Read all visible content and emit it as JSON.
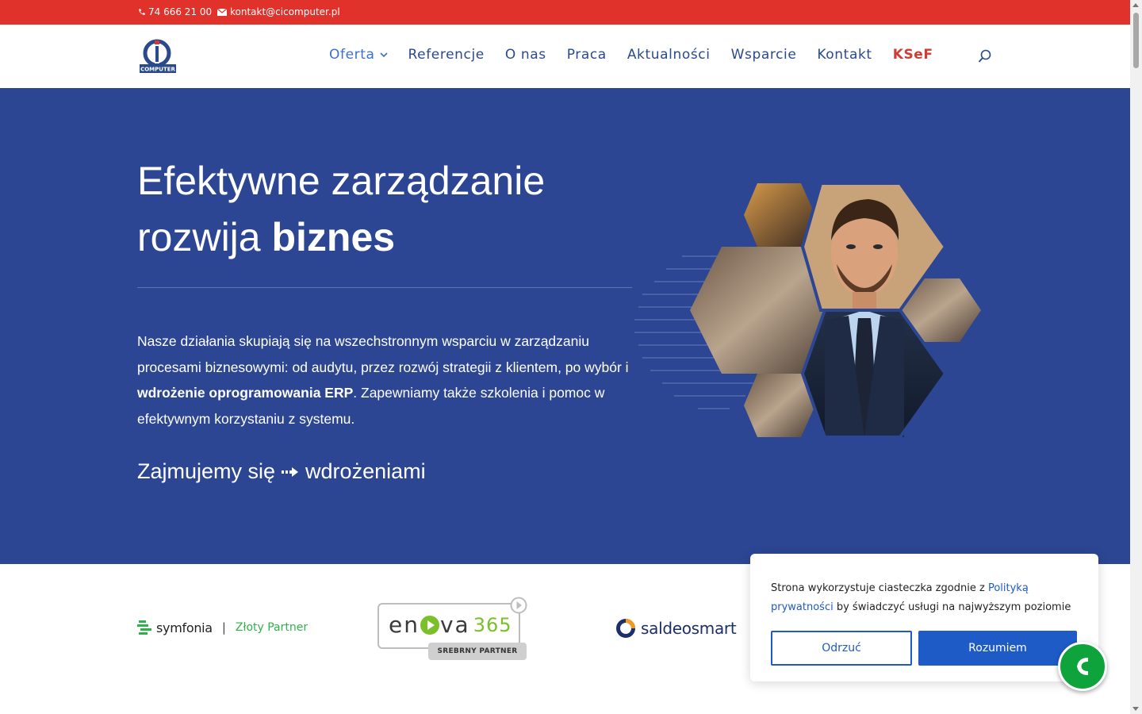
{
  "topbar": {
    "phone": "74 666 21 00",
    "email": "kontakt@cicomputer.pl",
    "phone_icon": "phone-icon",
    "email_icon": "envelope-icon",
    "background": "#e0312b"
  },
  "logo": {
    "text": "COMPUTER"
  },
  "nav": {
    "items": [
      {
        "label": "Oferta",
        "has_dropdown": true
      },
      {
        "label": "Referencje"
      },
      {
        "label": "O nas"
      },
      {
        "label": "Praca"
      },
      {
        "label": "Aktualności"
      },
      {
        "label": "Wsparcie"
      },
      {
        "label": "Kontakt"
      },
      {
        "label": "KSeF"
      }
    ],
    "search_icon": "search-icon",
    "text_color": "#2a4a8c",
    "highlight_color": "#d33a35"
  },
  "hero": {
    "background": "#2c4694",
    "title_line1": "Efektywne zarządzanie",
    "title_line2_prefix": "rozwija",
    "title_line2_bold": "biznes",
    "description_part1": "Nasze działania skupiają się na wszechstronnym wsparciu w zarządzaniu procesami biznesowymi: od audytu, przez rozwój strategii z klientem, po wybór i",
    "description_bold": "wdrożenie oprogramowania ERP",
    "description_part2": ". Zapewniamy także szkolenia i pomoc w efektywnym korzystaniu z systemu.",
    "tagline_prefix": "Zajmujemy się",
    "tagline_suffix": "wdrożeniami",
    "tagline_icon": "arrow-right-icon"
  },
  "partners": {
    "symfonia_name": "symfonia",
    "symfonia_separator": "|",
    "symfonia_level": "Złoty Partner",
    "enova_name": "en",
    "enova_name_end": "va",
    "enova_number": "365",
    "enova_level": "SREBRNY PARTNER",
    "saldeo_name": "saldeosmart"
  },
  "cookie": {
    "text_before": "Strona wykorzystuje ciasteczka zgodnie z",
    "link_text": "Polityką prywatności",
    "text_after": "by świadczyć usługi na najwyższym poziomie",
    "reject_label": "Odrzuć",
    "accept_label": "Rozumiem",
    "accent": "#1e5bc6"
  },
  "call_button": {
    "icon": "phone-call-icon",
    "color": "#0fa33b"
  }
}
